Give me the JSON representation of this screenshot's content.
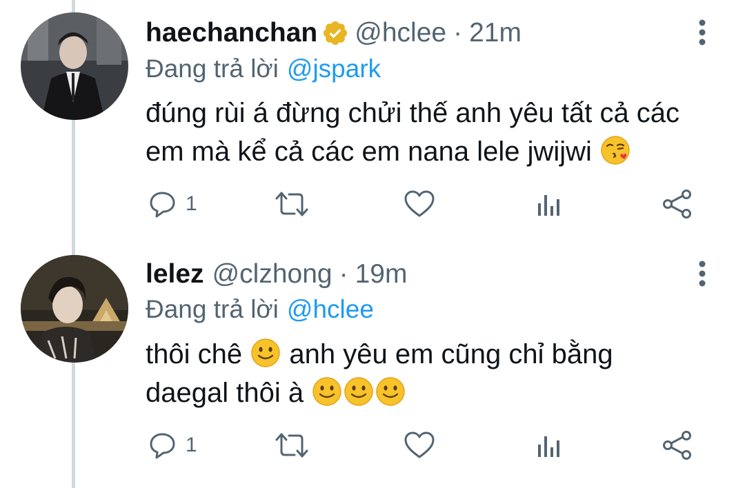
{
  "tweets": [
    {
      "display_name": "haechanchan",
      "verified": true,
      "handle": "@hclee",
      "separator": "·",
      "time": "21m",
      "reply_label": "Đang trả lời",
      "reply_to": "@jspark",
      "text_line1": "đúng rùi á đừng chửi thế anh yêu tất cả các",
      "text_line2": "em mà kể cả các em nana lele jwijwi",
      "emoji": [
        "face-blowing-kiss"
      ],
      "reply_count": "1"
    },
    {
      "display_name": "lelez",
      "verified": false,
      "handle": "@clzhong",
      "separator": "·",
      "time": "19m",
      "reply_label": "Đang trả lời",
      "reply_to": "@hclee",
      "text_part1": "thôi chê",
      "text_part2": "anh yêu em cũng chỉ bằng",
      "text_line2": "daegal thôi à",
      "emoji": [
        "slightly-smiling-face",
        "slightly-smiling-face",
        "slightly-smiling-face",
        "slightly-smiling-face"
      ],
      "reply_count": "1"
    }
  ],
  "icons": {
    "reply": "speech-bubble-icon",
    "retweet": "retweet-arrows-icon",
    "like": "heart-icon",
    "analytics": "bar-chart-icon",
    "share": "share-icon",
    "more": "vertical-dots-icon",
    "verified": "verified-badge-icon"
  },
  "colors": {
    "primary_text": "#0f1419",
    "secondary_text": "#536471",
    "link": "#1d9bf0",
    "verified_badge": "#e8b523",
    "thread_line": "#cfd9de"
  }
}
